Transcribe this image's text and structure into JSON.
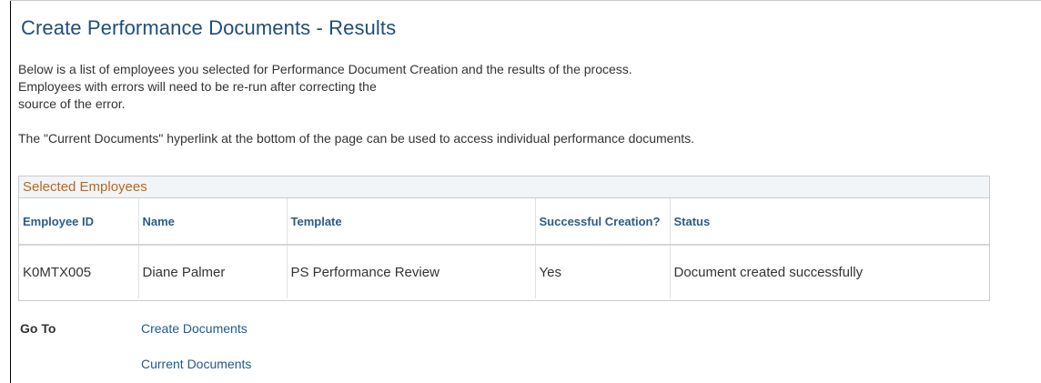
{
  "page": {
    "title": "Create Performance Documents - Results"
  },
  "instructions": {
    "line1": "Below is a list of employees you selected for Performance Document Creation and the results of the process.",
    "line2": "Employees with errors will need to be re-run after correcting the",
    "line3": "source of the error.",
    "line4": "The \"Current Documents\" hyperlink at the bottom of the page can be used to access individual performance documents."
  },
  "grid": {
    "caption": "Selected Employees",
    "columns": {
      "employee_id": "Employee ID",
      "name": "Name",
      "template": "Template",
      "successful_creation": "Successful Creation?",
      "status": "Status"
    },
    "rows": [
      {
        "employee_id": "K0MTX005",
        "name": "Diane Palmer",
        "template": "PS Performance Review",
        "successful_creation": "Yes",
        "status": "Document created successfully"
      }
    ]
  },
  "goto": {
    "label": "Go To",
    "links": [
      {
        "label": "Create Documents"
      },
      {
        "label": "Current Documents"
      }
    ]
  },
  "colors": {
    "title": "#1f4e79",
    "caption": "#c0651a",
    "header": "#2a5c8a",
    "link": "#1d5a93"
  }
}
